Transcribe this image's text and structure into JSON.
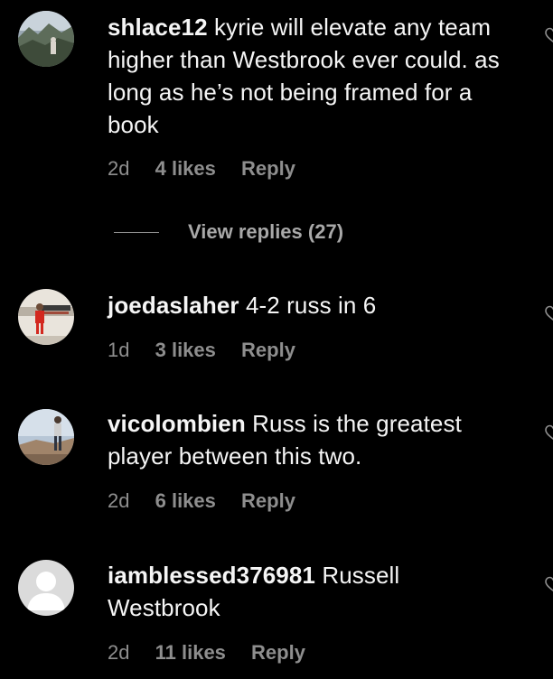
{
  "comments": [
    {
      "username": "shlace12",
      "text": "kyrie will elevate any team higher than Westbrook ever could. as long as he’s not being framed for a book",
      "time": "2d",
      "likes": "4 likes",
      "reply": "Reply",
      "avatar": "mountain-landscape-photo"
    },
    {
      "username": "joedaslaher",
      "text": "4-2 russ in 6",
      "time": "1d",
      "likes": "3 likes",
      "reply": "Reply",
      "avatar": "player-in-red-jersey-photo"
    },
    {
      "username": "vicolombien",
      "text": "Russ is the greatest player between this two.",
      "time": "2d",
      "likes": "6 likes",
      "reply": "Reply",
      "avatar": "person-standing-outdoors-photo"
    },
    {
      "username": "iamblessed376981",
      "text": "Russell Westbrook",
      "time": "2d",
      "likes": "11 likes",
      "reply": "Reply",
      "avatar": "default-user-avatar"
    }
  ],
  "view_replies": {
    "label": "View replies (27)"
  },
  "colors": {
    "background": "#000000",
    "primary_text": "#f5f5f5",
    "secondary_text": "#8e8e8e"
  },
  "icons": {
    "like": "heart-outline-icon"
  }
}
